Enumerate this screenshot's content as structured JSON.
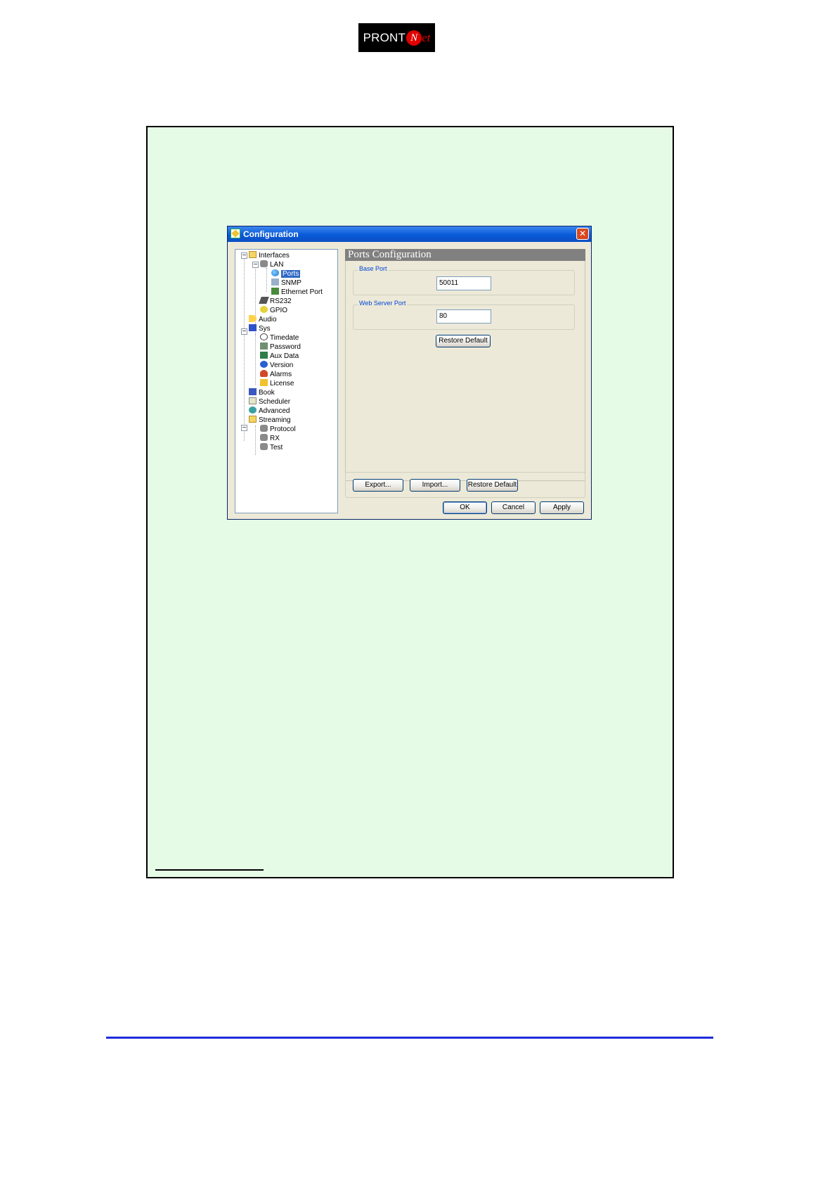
{
  "logo": {
    "text_main": "PRONT",
    "text_n": "N",
    "text_tail": "et"
  },
  "window": {
    "title": "Configuration",
    "close_glyph": "✕"
  },
  "tree": [
    {
      "label": "Interfaces",
      "icon": "folder-icon",
      "expander": "−"
    },
    {
      "label": "LAN",
      "icon": "network-icon",
      "expander": "−"
    },
    {
      "label": "Ports",
      "icon": "globe-icon",
      "selected": true
    },
    {
      "label": "SNMP",
      "icon": "snmp-icon"
    },
    {
      "label": "Ethernet Port",
      "icon": "ethernet-icon"
    },
    {
      "label": "RS232",
      "icon": "serial-cable-icon"
    },
    {
      "label": "GPIO",
      "icon": "gpio-icon"
    },
    {
      "label": "Audio",
      "icon": "speaker-icon"
    },
    {
      "label": "Sys",
      "icon": "monitor-icon",
      "expander": "−"
    },
    {
      "label": "Timedate",
      "icon": "clock-icon"
    },
    {
      "label": "Password",
      "icon": "key-icon"
    },
    {
      "label": "Aux Data",
      "icon": "aux-data-icon"
    },
    {
      "label": "Version",
      "icon": "info-icon"
    },
    {
      "label": "Alarms",
      "icon": "alarm-icon"
    },
    {
      "label": "License",
      "icon": "lock-icon"
    },
    {
      "label": "Book",
      "icon": "book-icon"
    },
    {
      "label": "Scheduler",
      "icon": "scheduler-icon"
    },
    {
      "label": "Advanced",
      "icon": "advanced-icon"
    },
    {
      "label": "Streaming",
      "icon": "folder-icon",
      "expander": "−"
    },
    {
      "label": "Protocol",
      "icon": "network-icon"
    },
    {
      "label": "RX",
      "icon": "network-icon"
    },
    {
      "label": "Test",
      "icon": "network-icon"
    }
  ],
  "panel": {
    "title": "Ports Configuration",
    "base_port": {
      "label": "Base Port",
      "value": "50011"
    },
    "web_server_port": {
      "label": "Web Server Port",
      "value": "80"
    },
    "restore_default_label": "Restore Default"
  },
  "bottom_buttons": {
    "export_label": "Export...",
    "import_label": "Import...",
    "restore_default_label": "Restore Default"
  },
  "dialog_buttons": {
    "ok_label": "OK",
    "cancel_label": "Cancel",
    "apply_label": "Apply"
  },
  "colors": {
    "frame_background": "#e6fbe6",
    "window_face": "#ece9d8",
    "title_bar": "#0a5ad8",
    "selection": "#316ac5",
    "blue_rule": "#1e2bdc"
  }
}
